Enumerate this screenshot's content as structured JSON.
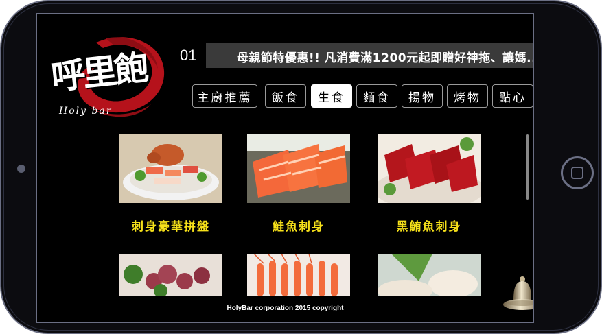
{
  "app": {
    "logo_text": "呼里飽",
    "logo_subtitle": "Holy bar"
  },
  "marquee": {
    "slide_number": "01",
    "text": "母親節特優惠!! 凡消費滿1200元起即贈好神拖、讓媽..."
  },
  "tabs": [
    {
      "label": "主廚推薦",
      "active": false
    },
    {
      "label": "飯食",
      "active": false
    },
    {
      "label": "生食",
      "active": true
    },
    {
      "label": "麵食",
      "active": false
    },
    {
      "label": "揚物",
      "active": false
    },
    {
      "label": "烤物",
      "active": false
    },
    {
      "label": "點心",
      "active": false
    }
  ],
  "menu_items": [
    {
      "name": "刺身豪華拼盤",
      "image": "sashimi-platter-image"
    },
    {
      "name": "鮭魚刺身",
      "image": "salmon-sashimi-image"
    },
    {
      "name": "黑鮪魚刺身",
      "image": "tuna-sashimi-image"
    },
    {
      "name": "",
      "image": "octopus-image"
    },
    {
      "name": "",
      "image": "shrimp-image"
    },
    {
      "name": "",
      "image": "scallop-image"
    }
  ],
  "footer": {
    "copyright": "HolyBar corporation 2015 copyright"
  },
  "colors": {
    "accent_yellow": "#f7e11a",
    "logo_red": "#b5121b",
    "background": "#000000"
  },
  "icons": {
    "bell": "bell-icon",
    "home": "home-button-icon"
  }
}
